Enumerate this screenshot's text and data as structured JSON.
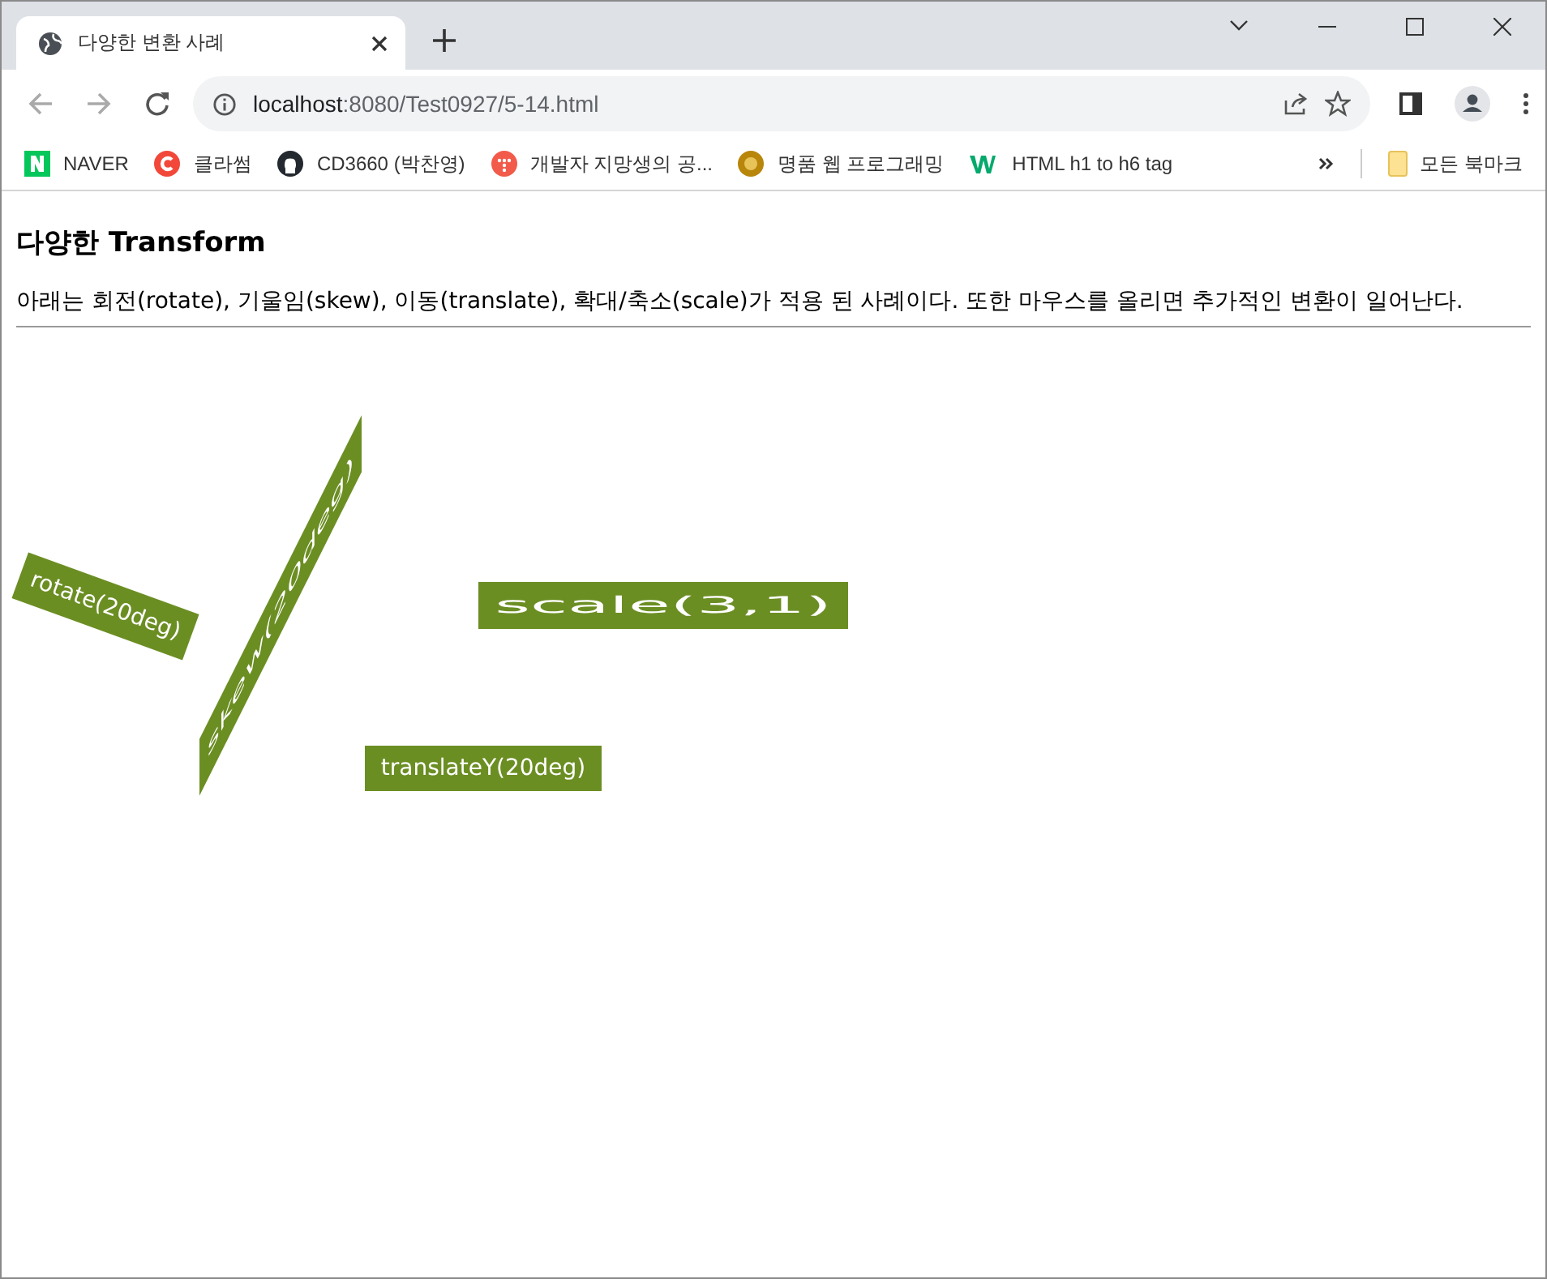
{
  "window": {
    "title": "다양한 변환 사례"
  },
  "address_bar": {
    "host": "localhost",
    "path": ":8080/Test0927/5-14.html"
  },
  "bookmarks": [
    {
      "label": "NAVER",
      "kind": "naver"
    },
    {
      "label": "클라썸",
      "kind": "classum"
    },
    {
      "label": "CD3660 (박찬영)",
      "kind": "github"
    },
    {
      "label": "개발자 지망생의 공...",
      "kind": "tistory"
    },
    {
      "label": "명품 웹 프로그래밍",
      "kind": "coin"
    },
    {
      "label": "HTML h1 to h6 tag",
      "kind": "w3"
    }
  ],
  "all_bookmarks": "모든 북마크",
  "page": {
    "heading": "다양한 Transform",
    "paragraph": "아래는 회전(rotate), 기울임(skew), 이동(translate), 확대/축소(scale)가 적용 된 사례이다. 또한 마우스를 올리면 추가적인 변환이 일어난다.",
    "boxes": [
      {
        "label": "rotate(20deg)",
        "kind": "rotate"
      },
      {
        "label": "skew(20deg)",
        "kind": "skew"
      },
      {
        "label": "scale(3,1)",
        "kind": "scale"
      },
      {
        "label": "translateY(20deg)",
        "kind": "translate"
      }
    ]
  }
}
